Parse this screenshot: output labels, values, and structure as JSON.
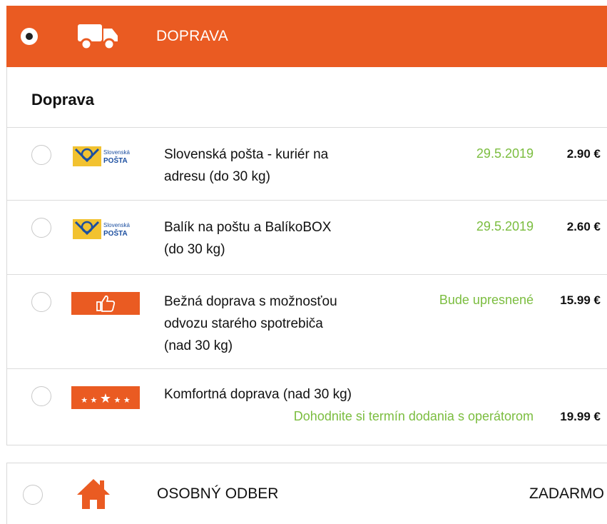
{
  "header": {
    "title": "DOPRAVA",
    "selected": true,
    "icon": "truck-icon",
    "accent_color": "#ea5b22"
  },
  "section": {
    "title": "Doprava"
  },
  "options": [
    {
      "logo": "slovenska-posta-logo",
      "logo_text_1": "Slovenská",
      "logo_text_2": "POŠTA",
      "label_lines": [
        "Slovenská pošta - kuriér na",
        "adresu (do 30 kg)"
      ],
      "date": "29.5.2019",
      "price": "2.90 €"
    },
    {
      "logo": "slovenska-posta-logo",
      "logo_text_1": "Slovenská",
      "logo_text_2": "POŠTA",
      "label_lines": [
        "Balík na poštu a BalíkoBOX",
        "(do 30 kg)"
      ],
      "date": "29.5.2019",
      "price": "2.60 €"
    },
    {
      "logo": "thumbs-up-icon",
      "label_lines": [
        "Bežná doprava s možnosťou",
        "odvozu starého spotrebiča",
        "(nad 30 kg)"
      ],
      "date": "Bude upresnené",
      "price": "15.99 €"
    },
    {
      "logo": "stars-icon",
      "label_lines": [
        "Komfortná doprava (nad 30 kg)"
      ],
      "date": "Dohodnite si termín dodania s operátorom",
      "price": "19.99 €"
    }
  ],
  "pickup": {
    "title": "OSOBNÝ ODBER",
    "price": "ZADARMO",
    "icon": "house-icon"
  },
  "colors": {
    "date_green": "#7bbd3f",
    "accent": "#ea5b22"
  }
}
